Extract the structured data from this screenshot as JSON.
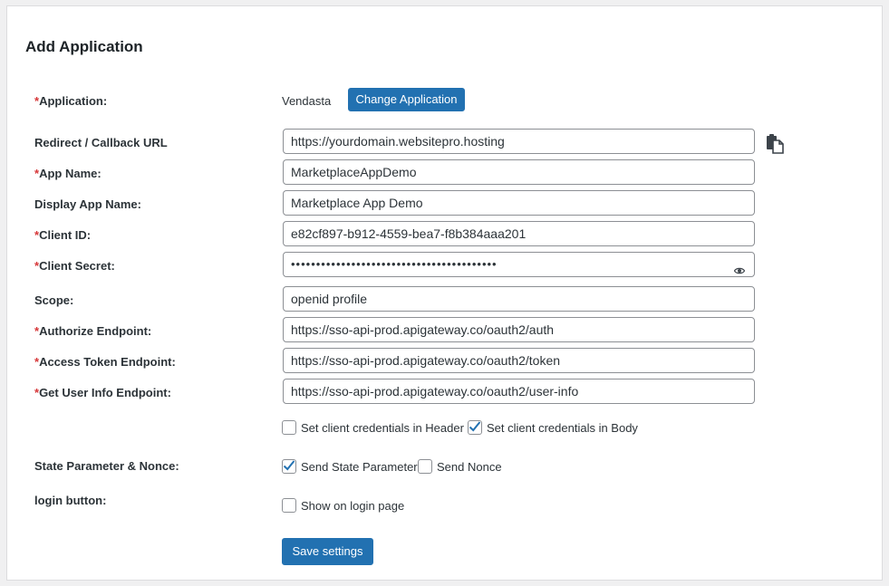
{
  "header": {
    "title": "Add Application"
  },
  "application": {
    "label_req": "*",
    "label": "Application:",
    "value": "Vendasta",
    "change_button": "Change Application"
  },
  "fields": {
    "redirect": {
      "label": "Redirect / Callback URL",
      "value": "https://yourdomain.websitepro.hosting"
    },
    "app_name": {
      "req": "*",
      "label": "App Name:",
      "value": "MarketplaceAppDemo"
    },
    "display_app_name": {
      "label": "Display App Name:",
      "value": "Marketplace App Demo"
    },
    "client_id": {
      "req": "*",
      "label": "Client ID:",
      "value": "e82cf897-b912-4559-bea7-f8b384aaa201"
    },
    "client_secret": {
      "req": "*",
      "label": "Client Secret:",
      "value": "•••••••••••••••••••••••••••••••••••••••••"
    },
    "scope": {
      "label": "Scope:",
      "value": "openid profile"
    },
    "authorize_endpoint": {
      "req": "*",
      "label": "Authorize Endpoint:",
      "value": "https://sso-api-prod.apigateway.co/oauth2/auth"
    },
    "access_token_endpoint": {
      "req": "*",
      "label": "Access Token Endpoint:",
      "value": "https://sso-api-prod.apigateway.co/oauth2/token"
    },
    "user_info_endpoint": {
      "req": "*",
      "label": "Get User Info Endpoint:",
      "value": "https://sso-api-prod.apigateway.co/oauth2/user-info"
    }
  },
  "credentials": {
    "header_label": "Set client credentials in Header",
    "header_checked": false,
    "body_label": "Set client credentials in Body",
    "body_checked": true
  },
  "state": {
    "label": "State Parameter & Nonce:",
    "send_state_label": "Send State Parameter",
    "send_state_checked": true,
    "send_nonce_label": "Send Nonce",
    "send_nonce_checked": false
  },
  "login_button": {
    "label": "login button:",
    "show_label": "Show on login page",
    "show_checked": false
  },
  "actions": {
    "save_label": "Save settings"
  },
  "icons": {
    "copy": "clipboard-copy-icon",
    "eye": "eye-icon",
    "check": "checkmark-icon"
  },
  "colors": {
    "accent": "#2271b1",
    "required": "#d63638",
    "check": "#2271b1"
  }
}
